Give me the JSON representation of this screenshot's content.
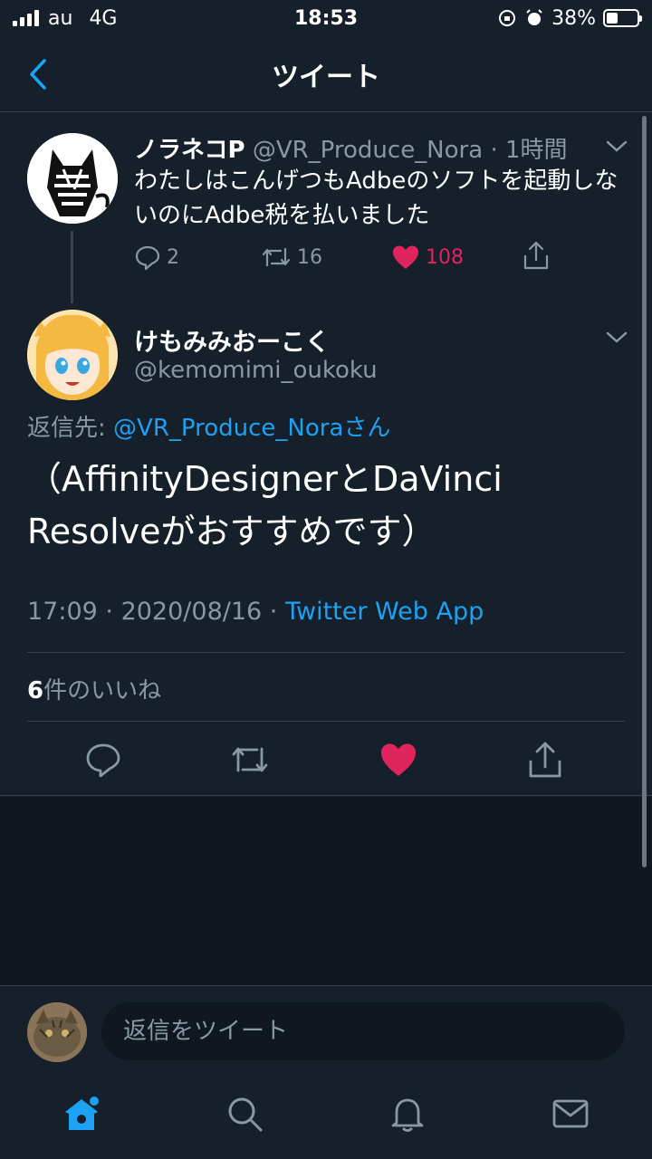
{
  "status_bar": {
    "carrier": "au",
    "network": "4G",
    "time": "18:53",
    "battery": "38%",
    "battery_level": 0.38
  },
  "nav": {
    "title": "ツイート",
    "back_icon": "chevron-left-icon"
  },
  "parent_tweet": {
    "name": "ノラネコP",
    "handle": "@VR_Produce_Nora",
    "time": "· 1時間",
    "text": "わたしはこんげつもAdbeのソフトを起動しないのにAdbe税を払いました",
    "replies": "2",
    "retweets": "16",
    "likes": "108"
  },
  "main_tweet": {
    "name": "けもみみおーこく",
    "handle": "@kemomimi_oukoku",
    "reply_label": "返信先: ",
    "reply_mention": "@VR_Produce_Noraさん",
    "text": "（AffinityDesignerとDaVinci Resolveがおすすめです）",
    "time": "17:09",
    "date": "2020/08/16",
    "app": "Twitter Web App",
    "like_count": "6",
    "like_label": "件のいいね"
  },
  "compose": {
    "placeholder": "返信をツイート"
  },
  "colors": {
    "background": "#15202b",
    "accent": "#1da1f2",
    "like": "#e0245e",
    "secondary_text": "#8899a6",
    "divider": "#38444d"
  },
  "tabs": [
    "home-icon",
    "search-icon",
    "bell-icon",
    "mail-icon"
  ]
}
